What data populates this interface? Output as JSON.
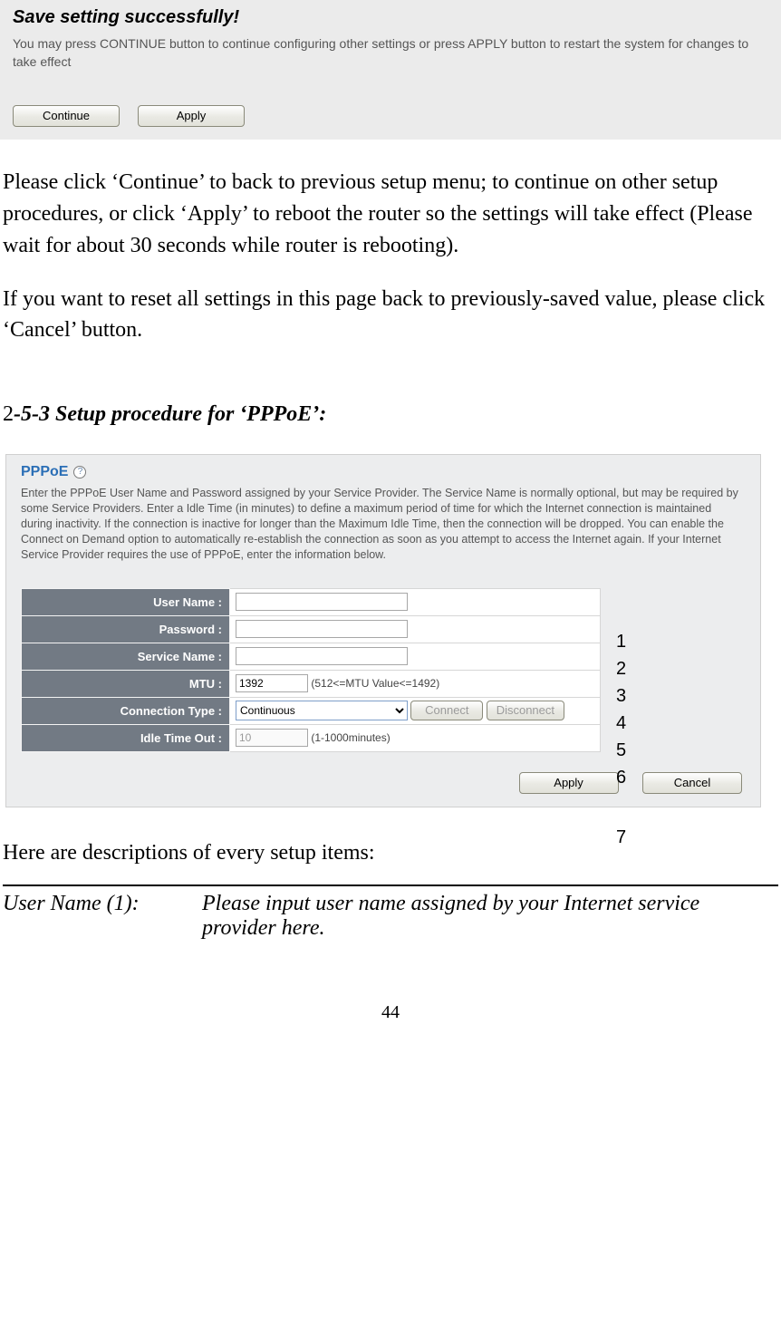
{
  "dlg1": {
    "title": "Save setting successfully!",
    "hint": "You may press CONTINUE button to continue configuring other settings or press APPLY button to restart the system for changes to take effect",
    "continue_btn": "Continue",
    "apply_btn": "Apply"
  },
  "body": {
    "p1": "Please click ‘Continue’ to back to previous setup menu; to continue on other setup procedures, or click ‘Apply’ to reboot the router so the settings will take effect (Please wait for about 30 seconds while router is rebooting).",
    "p2": "If you want to reset all settings in this page back to previously-saved value, please click ‘Cancel’ button."
  },
  "section": {
    "leading": "2",
    "heading": "-5-3 Setup procedure for ‘PPPoE’:"
  },
  "pppoe": {
    "title": "PPPoE",
    "desc": "Enter the PPPoE User Name and Password assigned by your Service Provider. The Service Name is normally optional, but may be required by some Service Providers. Enter a Idle Time (in minutes) to define a maximum period of time for which the Internet connection is maintained during inactivity. If the connection is inactive for longer than the Maximum Idle Time, then the connection will be dropped. You can enable the Connect on Demand option to automatically re-establish the connection as soon as you attempt to access the Internet again.\nIf your Internet Service Provider requires the use of PPPoE, enter the information below.",
    "rows": {
      "username_label": "User Name :",
      "password_label": "Password :",
      "service_label": "Service Name :",
      "mtu_label": "MTU :",
      "mtu_value": "1392",
      "mtu_hint": "(512<=MTU Value<=1492)",
      "conn_label": "Connection Type :",
      "conn_value": "Continuous",
      "connect_btn": "Connect",
      "disconnect_btn": "Disconnect",
      "idle_label": "Idle Time Out :",
      "idle_value": "10",
      "idle_hint": "(1-1000minutes)"
    },
    "apply_btn": "Apply",
    "cancel_btn": "Cancel",
    "numbers": {
      "n1": "1",
      "n2": "2",
      "n3": "3",
      "n4": "4",
      "n5": "5",
      "n6": "6",
      "n7": "7"
    }
  },
  "here_text": "Here are descriptions of every setup items:",
  "def": {
    "term": "User Name (1):",
    "desc": "Please input user name assigned by your Internet service provider here."
  },
  "page_number": "44"
}
